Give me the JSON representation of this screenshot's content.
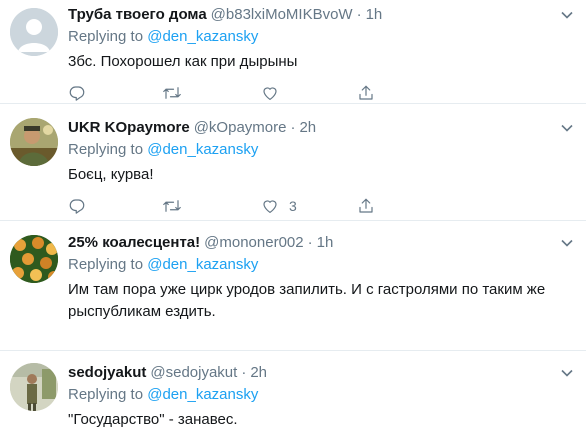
{
  "tweets": [
    {
      "name": "Труба твоего дома",
      "handle": "@b83lxiMoMIKBvoW",
      "time": "1h",
      "replying_prefix": "Replying to ",
      "replying_to": "@den_kazansky",
      "text": "3бс. Похорошел как при дырыны",
      "likes": ""
    },
    {
      "name": "UKR KOpaymore",
      "handle": "@kOpaymore",
      "time": "2h",
      "replying_prefix": "Replying to ",
      "replying_to": "@den_kazansky",
      "text": "Боєц, курва!",
      "likes": "3"
    },
    {
      "name": "25% коалесцента!",
      "handle": "@mononer002",
      "time": "1h",
      "replying_prefix": "Replying to ",
      "replying_to": "@den_kazansky",
      "text": "Им там пора уже цирк уродов запилить. И с гастролями по таким же рыспубликам ездить.",
      "likes": ""
    },
    {
      "name": "sedojyakut",
      "handle": "@sedojyakut",
      "time": "2h",
      "replying_prefix": "Replying to ",
      "replying_to": "@den_kazansky",
      "text": "\"Государство\" - занавес.",
      "likes": ""
    }
  ],
  "icons": {
    "reply": "reply-icon",
    "retweet": "retweet-icon",
    "like": "heart-icon",
    "share": "share-icon",
    "more": "chevron-down-icon"
  },
  "colors": {
    "link": "#1da1f2",
    "secondary": "#657786",
    "border": "#e6ecf0"
  }
}
